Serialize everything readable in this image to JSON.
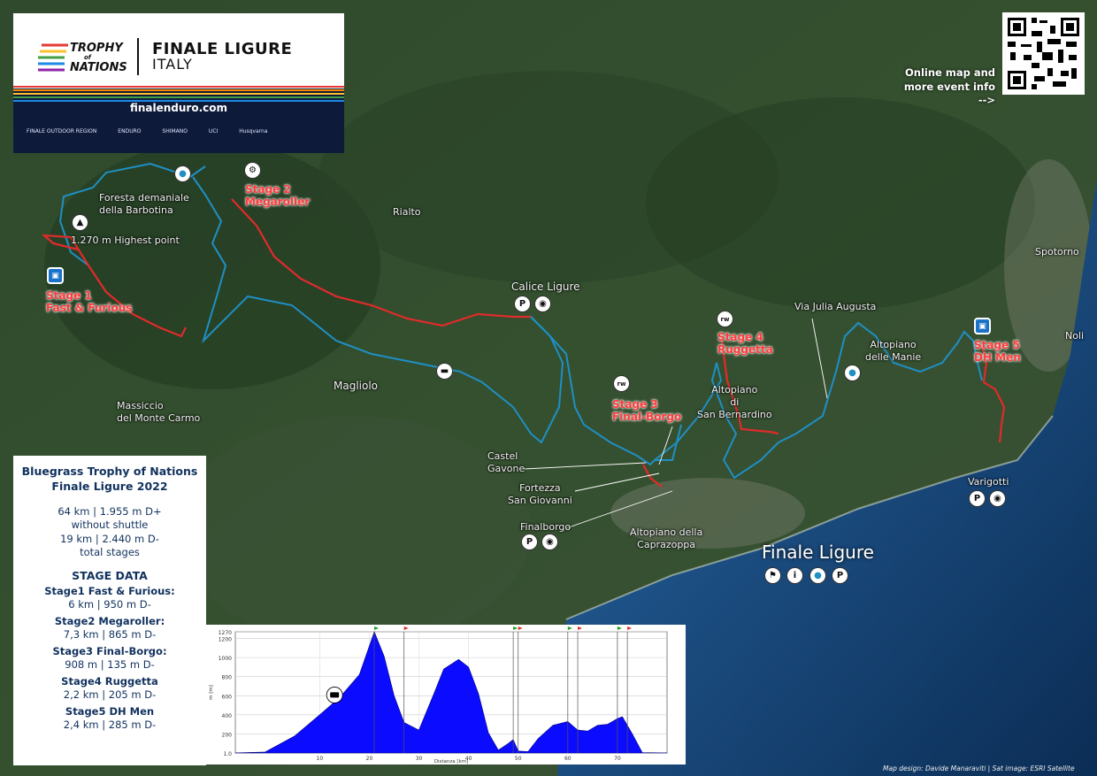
{
  "header": {
    "brand_line1": "TROPHY",
    "brand_line2": "of",
    "brand_line3": "NATIONS",
    "title": "FINALE LIGURE",
    "subtitle": "ITALY",
    "url": "finalenduro.com",
    "sponsors": [
      "FINALE OUTDOOR REGION",
      "ENDURO",
      "SHIMANO",
      "UCI",
      "Husqvarna"
    ]
  },
  "online": {
    "text1": "Online map and",
    "text2": "more event info",
    "arrow": "-->"
  },
  "places": {
    "foresta": "Foresta demaniale",
    "foresta2": "della Barbotina",
    "highest": "1.270 m Highest point",
    "rialto": "Rialto",
    "calice": "Calice Ligure",
    "magliolo": "Magliolo",
    "massiccio": "Massiccio",
    "massiccio2": "del Monte Carmo",
    "via_julia": "Via Julia Augusta",
    "altopiano_manie": "Altopiano",
    "altopiano_manie2": "delle Manie",
    "altopiano_sb": "Altopiano",
    "altopiano_sb2": "di",
    "altopiano_sb3": "San Bernardino",
    "spotorno": "Spotorno",
    "noli": "Noli",
    "castel": "Castel",
    "castel2": "Gavone",
    "fortezza": "Fortezza",
    "fortezza2": "San Giovanni",
    "finalborgo": "Finalborgo",
    "caprazoppa": "Altopiano della",
    "caprazoppa2": "Caprazoppa",
    "varigotti": "Varigotti",
    "finale": "Finale Ligure"
  },
  "stages": [
    {
      "line1": "Stage 1",
      "line2": "Fast & Furious"
    },
    {
      "line1": "Stage 2",
      "line2": "Megaroller"
    },
    {
      "line1": "Stage 3",
      "line2": "Final-Borgo"
    },
    {
      "line1": "Stage 4",
      "line2": "Ruggetta"
    },
    {
      "line1": "Stage 5",
      "line2": "DH Men"
    }
  ],
  "info": {
    "title1": "Bluegrass Trophy of Nations",
    "title2": "Finale Ligure 2022",
    "stat1": "64 km | 1.955 m D+",
    "stat1b": "without shuttle",
    "stat2": "19 km | 2.440 m D-",
    "stat2b": "total stages",
    "stage_data": "STAGE DATA",
    "s1": "Stage1 Fast & Furious:",
    "s1v": "6 km | 950 m D-",
    "s2": "Stage2 Megaroller:",
    "s2v": "7,3 km | 865 m D-",
    "s3": "Stage3 Final-Borgo:",
    "s3v": "908 m | 135 m D-",
    "s4": "Stage4 Ruggetta",
    "s4v": "2,2 km | 205 m D-",
    "s5": "Stage5 DH Men",
    "s5v": "2,4 km | 285 m D-"
  },
  "chart_data": {
    "type": "area",
    "xlabel": "Distanza [km]",
    "ylabel": "m [m]",
    "xlim": [
      -7,
      80
    ],
    "ylim": [
      0,
      1270
    ],
    "x_ticks": [
      "10",
      "20",
      "30",
      "40",
      "50",
      "60",
      "70"
    ],
    "y_ticks": [
      "1270",
      "1200",
      "1000",
      "800",
      "600",
      "400",
      "200",
      "1.0"
    ],
    "x": [
      -7,
      -1,
      5,
      10,
      14,
      18,
      21,
      23,
      25,
      27,
      30,
      33,
      35,
      38,
      40,
      42,
      44,
      46,
      48,
      49,
      50,
      52,
      54,
      57,
      60,
      62,
      64,
      66,
      68,
      70,
      71,
      73,
      75,
      80
    ],
    "y": [
      1,
      10,
      180,
      400,
      580,
      820,
      1270,
      1010,
      600,
      320,
      240,
      620,
      880,
      980,
      900,
      620,
      210,
      30,
      100,
      140,
      20,
      15,
      150,
      290,
      330,
      240,
      230,
      290,
      300,
      360,
      380,
      200,
      5,
      1
    ],
    "stage_markers_km": [
      21,
      27,
      49,
      50,
      60,
      62,
      70,
      72
    ],
    "shuttle_km": 13
  },
  "colors": {
    "route": "#1f8fc4",
    "stage": "#e02b2b",
    "profile": "#0b0bff",
    "navy": "#11325e",
    "sea": "#0d3f70"
  },
  "icons": [
    "mountain-peak-icon",
    "water-drop-icon",
    "bus-icon",
    "parking-icon",
    "camera-icon",
    "info-icon",
    "flag-icon",
    "qr-code"
  ],
  "credit": "Map design: Davide Manaraviti | Sat image: ESRI Satellite"
}
